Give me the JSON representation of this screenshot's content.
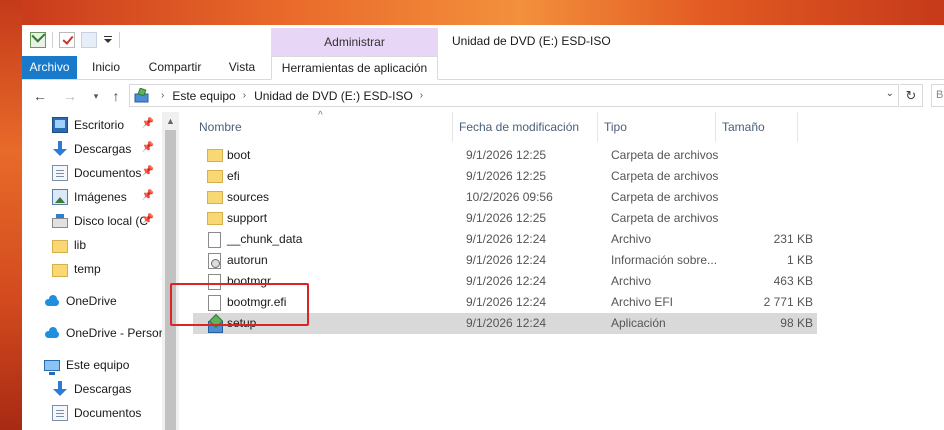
{
  "window": {
    "title": "Unidad de DVD (E:) ESD-ISO",
    "contextual_group": "Administrar"
  },
  "ribbon": {
    "tabs": [
      "Archivo",
      "Inicio",
      "Compartir",
      "Vista",
      "Herramientas de aplicación"
    ],
    "active_tab_color": "#1979ca",
    "contextual_color": "#e8d6f7"
  },
  "address": {
    "crumbs": [
      "Este equipo",
      "Unidad de DVD (E:) ESD-ISO"
    ]
  },
  "sidebar": {
    "items": [
      {
        "label": "Escritorio",
        "icon": "desktop-icon",
        "pinned": true
      },
      {
        "label": "Descargas",
        "icon": "downloads-icon",
        "pinned": true
      },
      {
        "label": "Documentos",
        "icon": "documents-icon",
        "pinned": true
      },
      {
        "label": "Imágenes",
        "icon": "pictures-icon",
        "pinned": true
      },
      {
        "label": "Disco local (C",
        "icon": "local-disk-icon",
        "pinned": true
      },
      {
        "label": "lib",
        "icon": "folder-icon",
        "pinned": false
      },
      {
        "label": "temp",
        "icon": "folder-icon",
        "pinned": false
      },
      {
        "label": "OneDrive",
        "icon": "onedrive-icon",
        "pinned": false
      },
      {
        "label": "OneDrive - Persor",
        "icon": "onedrive-icon",
        "pinned": false
      },
      {
        "label": "Este equipo",
        "icon": "this-pc-icon",
        "pinned": false
      },
      {
        "label": "Descargas",
        "icon": "downloads-icon",
        "pinned": false
      },
      {
        "label": "Documentos",
        "icon": "documents-icon",
        "pinned": false
      }
    ]
  },
  "columns": {
    "name": "Nombre",
    "date": "Fecha de modificación",
    "type": "Tipo",
    "size": "Tamaño"
  },
  "files": [
    {
      "name": "boot",
      "date": "9/1/2026 12:25",
      "type": "Carpeta de archivos",
      "size": "",
      "icon": "folder-icon"
    },
    {
      "name": "efi",
      "date": "9/1/2026 12:25",
      "type": "Carpeta de archivos",
      "size": "",
      "icon": "folder-icon"
    },
    {
      "name": "sources",
      "date": "10/2/2026 09:56",
      "type": "Carpeta de archivos",
      "size": "",
      "icon": "folder-icon"
    },
    {
      "name": "support",
      "date": "9/1/2026 12:25",
      "type": "Carpeta de archivos",
      "size": "",
      "icon": "folder-icon"
    },
    {
      "name": "__chunk_data",
      "date": "9/1/2026 12:24",
      "type": "Archivo",
      "size": "231 KB",
      "icon": "file-icon"
    },
    {
      "name": "autorun",
      "date": "9/1/2026 12:24",
      "type": "Información sobre...",
      "size": "1 KB",
      "icon": "setup-info-icon"
    },
    {
      "name": "bootmgr",
      "date": "9/1/2026 12:24",
      "type": "Archivo",
      "size": "463 KB",
      "icon": "file-icon"
    },
    {
      "name": "bootmgr.efi",
      "date": "9/1/2026 12:24",
      "type": "Archivo EFI",
      "size": "2 771 KB",
      "icon": "file-icon"
    },
    {
      "name": "setup",
      "date": "9/1/2026 12:24",
      "type": "Aplicación",
      "size": "98 KB",
      "icon": "setup-app-icon",
      "selected": true
    }
  ],
  "annotation": {
    "highlight_color": "#d9242a",
    "target": "setup"
  }
}
